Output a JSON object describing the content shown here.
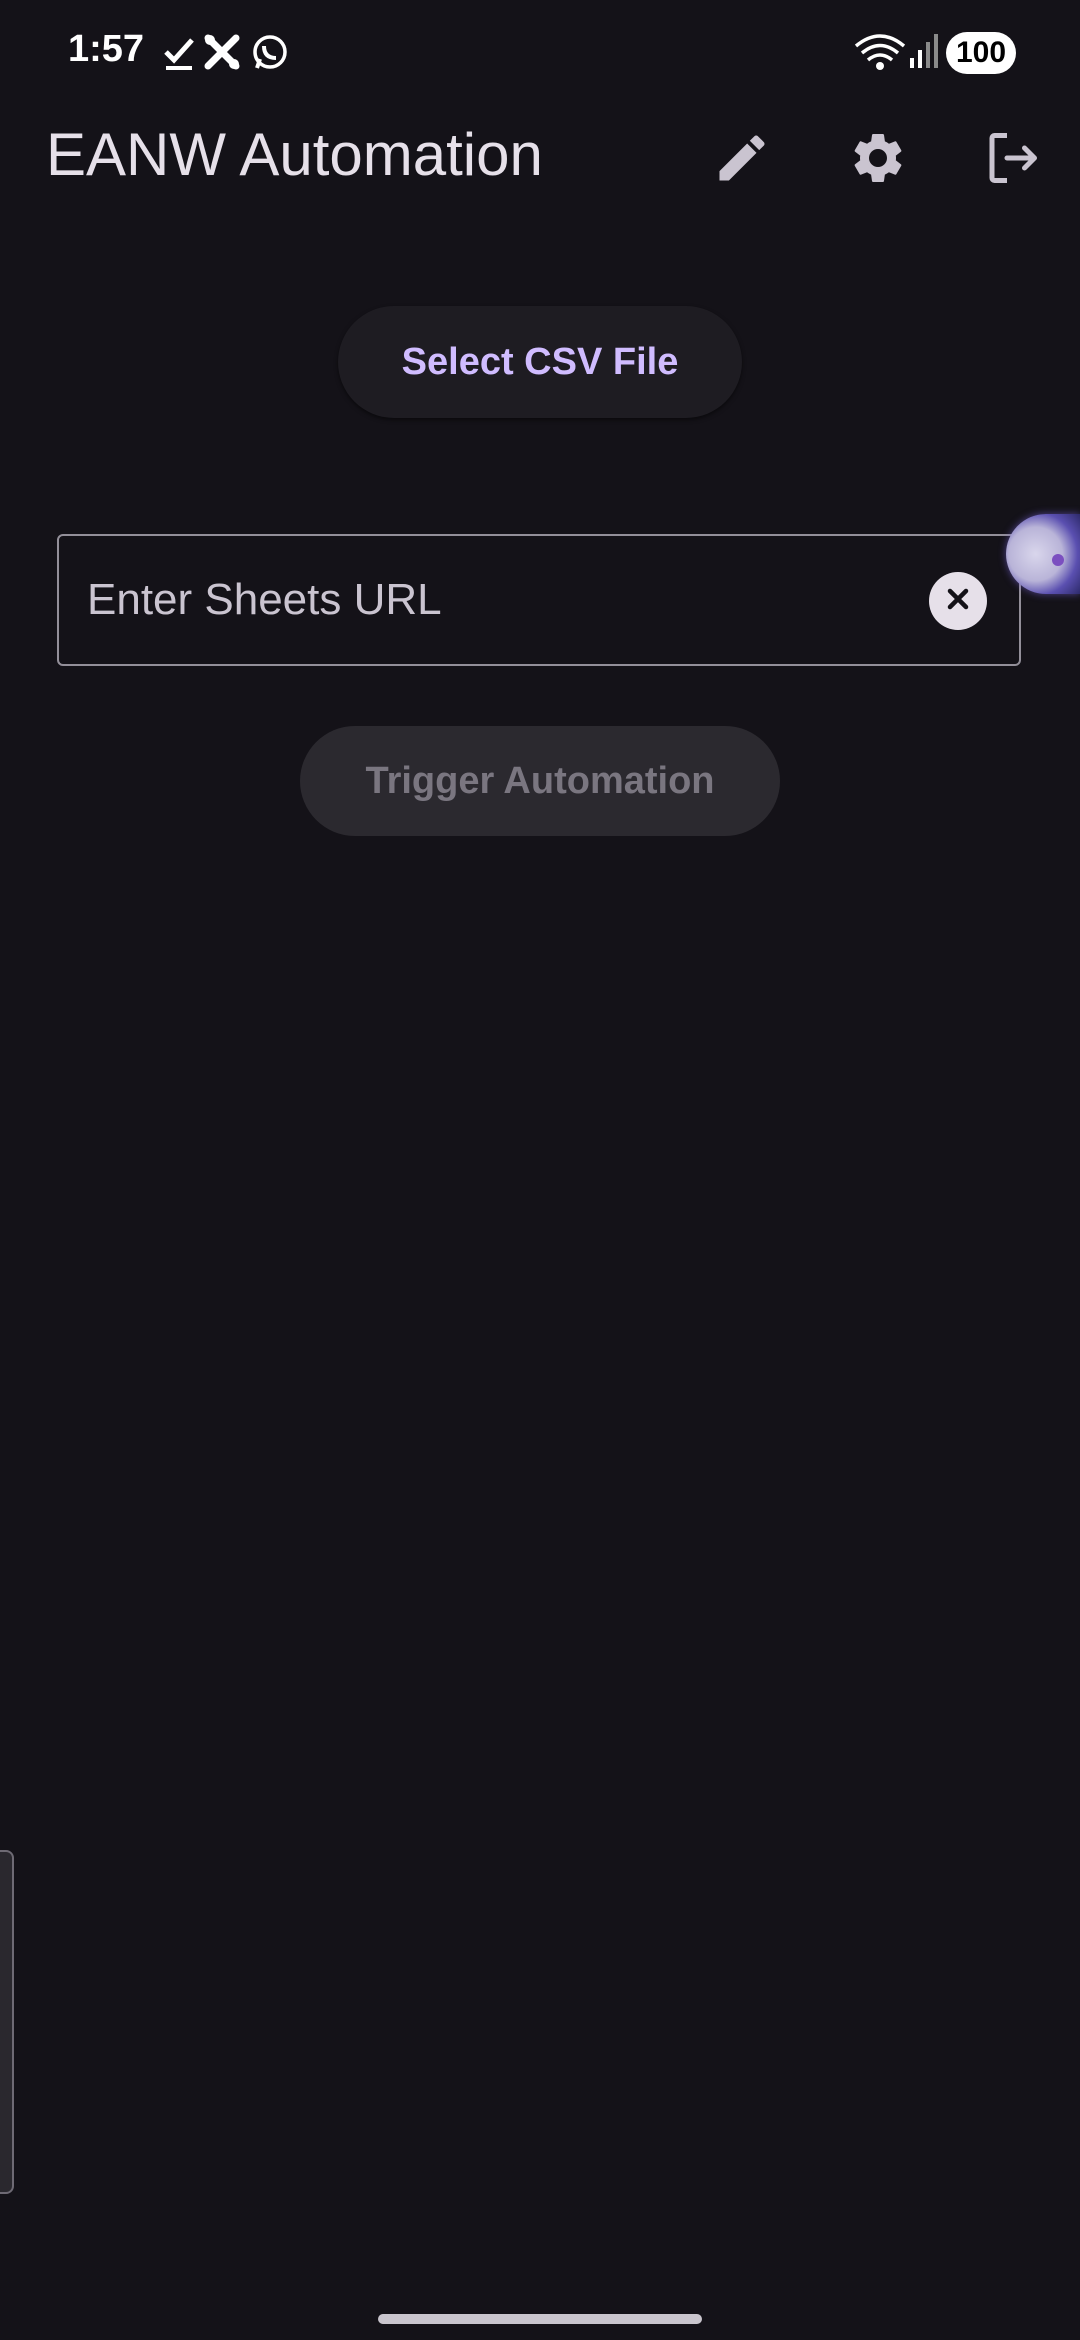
{
  "status_bar": {
    "time": "1:57",
    "battery": "100",
    "icons": [
      "check-icon",
      "tools-icon",
      "whatsapp-icon",
      "wifi-icon",
      "signal-icon"
    ]
  },
  "app_bar": {
    "title": "EANW Automation",
    "actions": [
      "edit-icon",
      "settings-icon",
      "logout-icon"
    ]
  },
  "main": {
    "select_csv_label": "Select CSV File",
    "url_field": {
      "placeholder": "Enter Sheets URL",
      "value": ""
    },
    "trigger_label": "Trigger Automation",
    "trigger_enabled": false
  },
  "colors": {
    "background": "#141218",
    "accent": "#d0bcff",
    "on_surface": "#e6e0e9",
    "outline": "#938f99",
    "disabled_bg": "#2b292f",
    "disabled_text": "#7a7680"
  }
}
